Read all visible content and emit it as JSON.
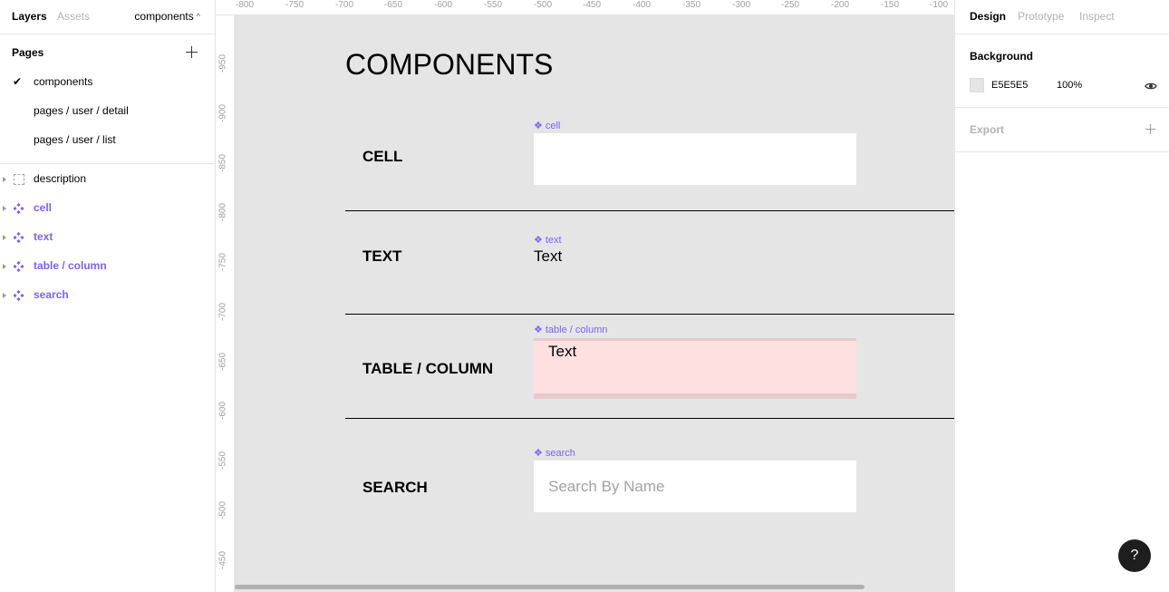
{
  "left_panel": {
    "tabs": {
      "layers": "Layers",
      "assets": "Assets"
    },
    "page_switcher": "components",
    "pages_header": "Pages",
    "pages": [
      "components",
      "pages / user / detail",
      "pages / user / list"
    ],
    "layers": [
      {
        "label": "description",
        "type": "frame"
      },
      {
        "label": "cell",
        "type": "component"
      },
      {
        "label": "text",
        "type": "component"
      },
      {
        "label": "table / column",
        "type": "component"
      },
      {
        "label": "search",
        "type": "component"
      }
    ]
  },
  "rulers": {
    "top": [
      "-800",
      "-750",
      "-700",
      "-650",
      "-600",
      "-550",
      "-500",
      "-450",
      "-400",
      "-350",
      "-300",
      "-250",
      "-200",
      "-150",
      "-100"
    ],
    "left": [
      "-950",
      "-900",
      "-850",
      "-800",
      "-750",
      "-700",
      "-650",
      "-600",
      "-550",
      "-500",
      "-450"
    ]
  },
  "canvas": {
    "title": "COMPONENTS",
    "rows": {
      "cell": {
        "label": "CELL",
        "tag": "cell"
      },
      "text": {
        "label": "TEXT",
        "tag": "text",
        "sample": "Text"
      },
      "table_column": {
        "label": "TABLE / COLUMN",
        "tag": "table / column",
        "sample": "Text"
      },
      "search": {
        "label": "SEARCH",
        "tag": "search",
        "placeholder": "Search By Name"
      }
    }
  },
  "right_panel": {
    "tabs": {
      "design": "Design",
      "prototype": "Prototype",
      "inspect": "Inspect"
    },
    "background_header": "Background",
    "background_hex": "E5E5E5",
    "background_opacity": "100%",
    "export_header": "Export",
    "colors": {
      "background": "#E5E5E5",
      "component_accent": "#7B61FF"
    }
  },
  "help_label": "?"
}
